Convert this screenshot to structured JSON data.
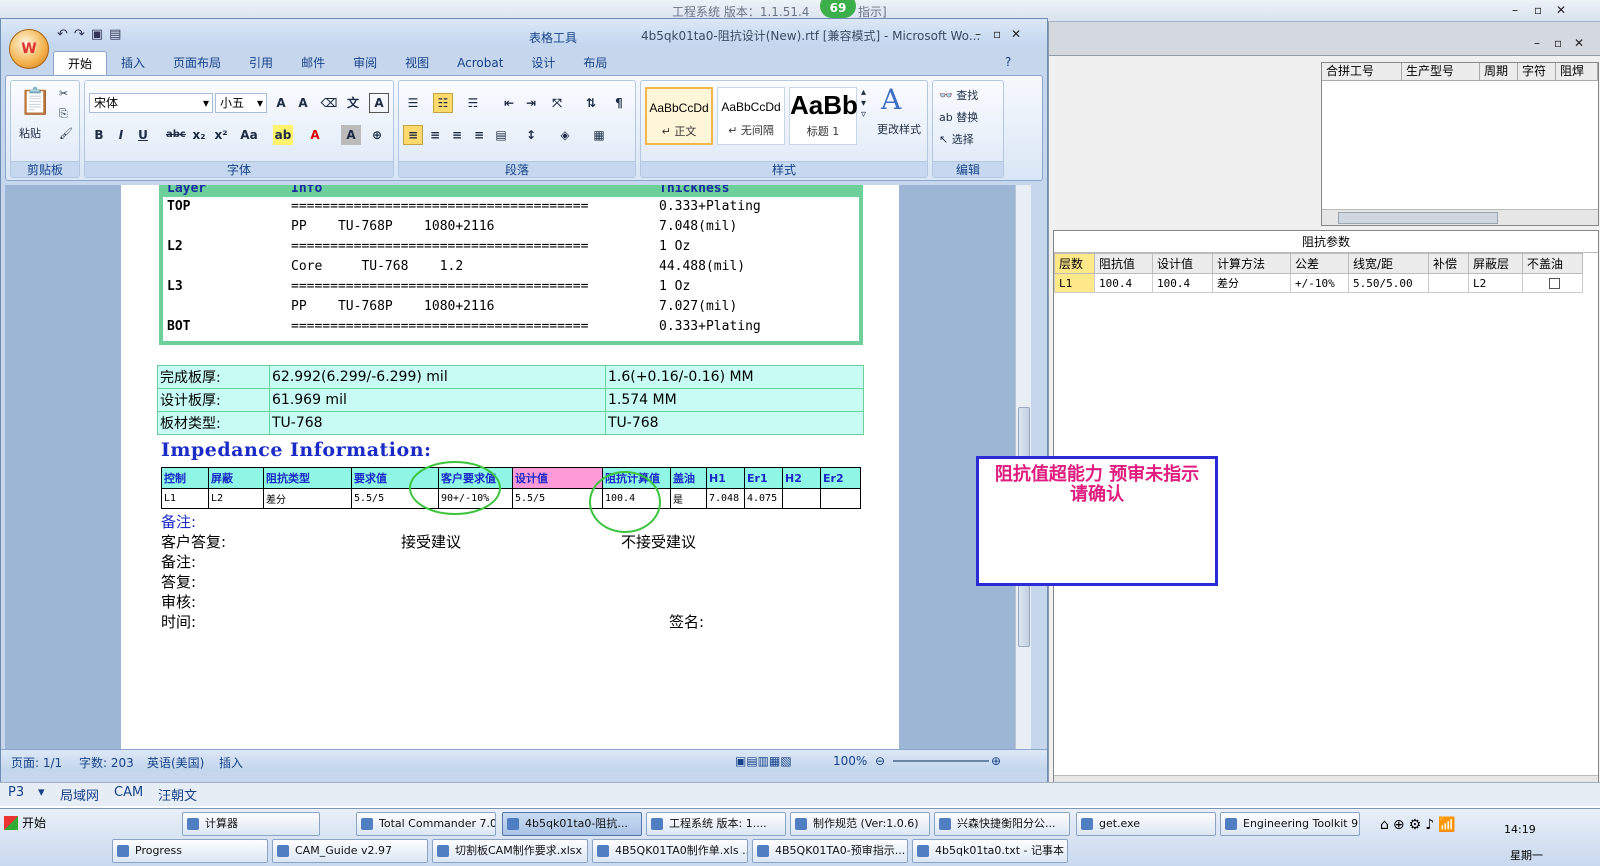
{
  "outer": {
    "title": "工程系统    版本：1.1.51.4",
    "title_tail": "指示]",
    "badge": "69",
    "right_grid1": {
      "headers": [
        "合拼工号",
        "生产型号",
        "周期",
        "字符",
        "阻焊"
      ]
    },
    "impedance_panel": {
      "caption": "阻抗参数",
      "headers": [
        "层数",
        "阻抗值",
        "设计值",
        "计算方法",
        "公差",
        "线宽/距",
        "补偿",
        "屏蔽层",
        "不盖油"
      ],
      "rows": [
        [
          "L1",
          "100.4",
          "100.4",
          "差分",
          "+/-10%",
          "5.50/5.00",
          "",
          "L2",
          ""
        ]
      ]
    }
  },
  "word": {
    "title": "4b5qk01ta0-阻抗设计(New).rtf [兼容模式] - Microsoft Wo...",
    "context_tab": "表格工具",
    "tabs": [
      "开始",
      "插入",
      "页面布局",
      "引用",
      "邮件",
      "审阅",
      "视图",
      "Acrobat",
      "设计",
      "布局"
    ],
    "ribbon": {
      "paste": "粘贴",
      "font_name": "宋体",
      "font_size": "小五",
      "groups": [
        "剪贴板",
        "字体",
        "段落",
        "样式",
        "编辑"
      ],
      "styles": [
        {
          "preview": "AaBbCcDd",
          "name": "↵ 正文"
        },
        {
          "preview": "AaBbCcDd",
          "name": "↵ 无间隔"
        },
        {
          "preview": "AaBb",
          "name": "标题 1"
        }
      ],
      "change_styles": "更改样式",
      "find": "查找",
      "replace": "替换",
      "select": "选择"
    },
    "layers": {
      "header": [
        "Layer",
        "Info",
        "Thickness"
      ],
      "rows": [
        [
          "TOP",
          "======================================",
          "0.333+Plating"
        ],
        [
          "",
          "PP    TU-768P    1080+2116",
          "7.048(mil)"
        ],
        [
          "L2",
          "======================================",
          "1 Oz"
        ],
        [
          "",
          "Core     TU-768    1.2",
          "44.488(mil)"
        ],
        [
          "L3",
          "======================================",
          "1 Oz"
        ],
        [
          "",
          "PP    TU-768P    1080+2116",
          "7.027(mil)"
        ],
        [
          "BOT",
          "======================================",
          "0.333+Plating"
        ]
      ]
    },
    "thickness_table": [
      [
        "完成板厚:",
        "62.992(6.299/-6.299) mil",
        "1.6(+0.16/-0.16) MM"
      ],
      [
        "设计板厚:",
        "61.969 mil",
        "1.574 MM"
      ],
      [
        "板材类型:",
        "TU-768",
        "TU-768"
      ]
    ],
    "impedance_title": "Impedance Information:",
    "impedance_table": {
      "headers": [
        "控制",
        "屏蔽",
        "阻抗类型",
        "要求值",
        "客户要求值",
        "设计值",
        "阻抗计算值",
        "盖油",
        "H1",
        "Er1",
        "H2",
        "Er2"
      ],
      "rows": [
        [
          "L1",
          "L2",
          "差分",
          "5.5/5",
          "90+/-10%",
          "5.5/5",
          "100.4",
          "是",
          "7.048",
          "4.075",
          "",
          ""
        ]
      ]
    },
    "notes": {
      "remark1": "备注:",
      "customer_reply": "客户答复:",
      "accept": "接受建议",
      "reject": "不接受建议",
      "remark2": "备注:",
      "reply": "答复:",
      "review": "审核:",
      "time": "时间:",
      "sign": "签名:"
    },
    "warning": "阻抗值超能力  预审未指示  请确认",
    "status": {
      "page": "页面: 1/1",
      "words": "字数: 203",
      "lang": "英语(美国)",
      "mode": "插入",
      "zoom": "100%"
    }
  },
  "bottom_bar": {
    "items": [
      "P3",
      "局域网",
      "CAM",
      "汪朝文"
    ]
  },
  "taskbar": {
    "start": "开始",
    "row1": [
      "计算器",
      "Total Commander 7.0...",
      "4b5qk01ta0-阻抗...",
      "工程系统  版本: 1....",
      "制作规范 (Ver:1.0.6)",
      "兴森快捷衡阳分公...",
      "get.exe",
      "Engineering Toolkit 9...."
    ],
    "row2": [
      "Progress",
      "CAM_Guide v2.97",
      "切割板CAM制作要求.xlsx",
      "4B5QK01TA0制作单.xls ...",
      "4B5QK01TA0-预审指示...",
      "4b5qk01ta0.txt - 记事本"
    ],
    "clock": "14:19",
    "weekday": "星期一"
  },
  "colors": {
    "accent": "#15428b",
    "green": "#6dcf9a",
    "cyan": "#c8fbf4",
    "header_cyan": "#8ff5e4",
    "pink": "#ff9ad8",
    "warning": "#e01c7e"
  }
}
